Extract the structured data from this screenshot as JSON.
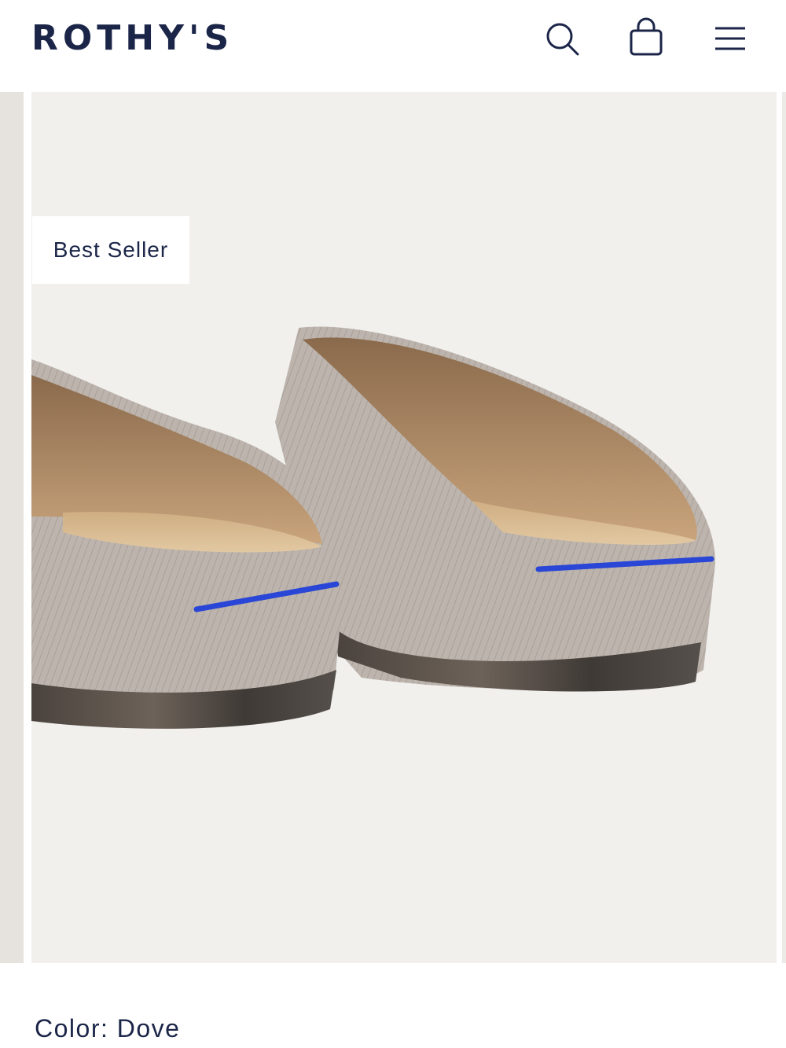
{
  "header": {
    "logo": "ROTHY'S",
    "icons": [
      "search-icon",
      "bag-icon",
      "menu-icon"
    ]
  },
  "product": {
    "badge": "Best Seller",
    "color_label": "Color:",
    "color_value": "Dove",
    "image_alt": "Rear view of a pair of dove grey knit slip-on mules with blue heel stripes and translucent soles"
  },
  "colors": {
    "brand_navy": "#1b2548",
    "image_background": "#f1f0ed",
    "knit": "#b9b1a9",
    "heel_stripe": "#2a46d6"
  }
}
